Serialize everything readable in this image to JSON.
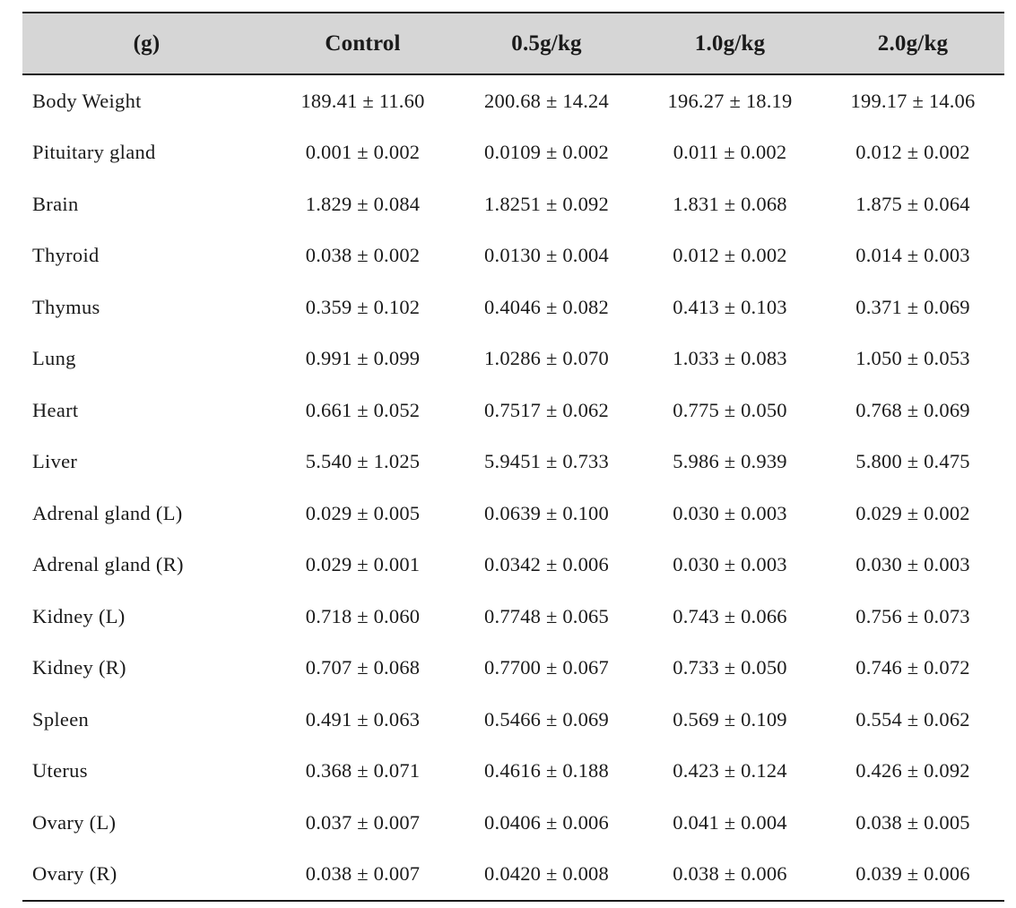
{
  "table": {
    "headers": [
      "(g)",
      "Control",
      "0.5g/kg",
      "1.0g/kg",
      "2.0g/kg"
    ],
    "header_background": "#d6d6d6",
    "rule_color": "#1a1a1a",
    "rows": [
      {
        "label": "Body Weight",
        "values": [
          "189.41 ± 11.60",
          "200.68 ± 14.24",
          "196.27 ± 18.19",
          "199.17 ± 14.06"
        ]
      },
      {
        "label": "Pituitary gland",
        "values": [
          "0.001 ± 0.002",
          "0.0109 ± 0.002",
          "0.011 ± 0.002",
          "0.012 ± 0.002"
        ]
      },
      {
        "label": "Brain",
        "values": [
          "1.829 ± 0.084",
          "1.8251 ± 0.092",
          "1.831 ± 0.068",
          "1.875 ± 0.064"
        ]
      },
      {
        "label": "Thyroid",
        "values": [
          "0.038 ± 0.002",
          "0.0130 ± 0.004",
          "0.012 ± 0.002",
          "0.014 ± 0.003"
        ]
      },
      {
        "label": "Thymus",
        "values": [
          "0.359 ± 0.102",
          "0.4046 ± 0.082",
          "0.413 ± 0.103",
          "0.371 ± 0.069"
        ]
      },
      {
        "label": "Lung",
        "values": [
          "0.991 ± 0.099",
          "1.0286 ± 0.070",
          "1.033 ± 0.083",
          "1.050 ± 0.053"
        ]
      },
      {
        "label": "Heart",
        "values": [
          "0.661 ± 0.052",
          "0.7517 ± 0.062",
          "0.775 ± 0.050",
          "0.768 ± 0.069"
        ]
      },
      {
        "label": "Liver",
        "values": [
          "5.540 ± 1.025",
          "5.9451 ± 0.733",
          "5.986 ± 0.939",
          "5.800 ± 0.475"
        ]
      },
      {
        "label": "Adrenal gland (L)",
        "values": [
          "0.029 ± 0.005",
          "0.0639 ± 0.100",
          "0.030 ± 0.003",
          "0.029 ± 0.002"
        ]
      },
      {
        "label": "Adrenal gland (R)",
        "values": [
          "0.029 ± 0.001",
          "0.0342 ± 0.006",
          "0.030 ± 0.003",
          "0.030 ± 0.003"
        ]
      },
      {
        "label": "Kidney (L)",
        "values": [
          "0.718 ± 0.060",
          "0.7748 ± 0.065",
          "0.743 ± 0.066",
          "0.756 ± 0.073"
        ]
      },
      {
        "label": "Kidney (R)",
        "values": [
          "0.707 ± 0.068",
          "0.7700 ± 0.067",
          "0.733 ± 0.050",
          "0.746 ± 0.072"
        ]
      },
      {
        "label": "Spleen",
        "values": [
          "0.491 ± 0.063",
          "0.5466 ± 0.069",
          "0.569 ± 0.109",
          "0.554 ± 0.062"
        ]
      },
      {
        "label": "Uterus",
        "values": [
          "0.368 ± 0.071",
          "0.4616 ± 0.188",
          "0.423 ± 0.124",
          "0.426 ± 0.092"
        ]
      },
      {
        "label": "Ovary (L)",
        "values": [
          "0.037 ± 0.007",
          "0.0406 ± 0.006",
          "0.041 ± 0.004",
          "0.038 ± 0.005"
        ]
      },
      {
        "label": "Ovary (R)",
        "values": [
          "0.038 ± 0.007",
          "0.0420 ± 0.008",
          "0.038 ± 0.006",
          "0.039 ± 0.006"
        ]
      }
    ]
  },
  "chart_data": {
    "type": "table",
    "title": "",
    "categories": [
      "Body Weight",
      "Pituitary gland",
      "Brain",
      "Thyroid",
      "Thymus",
      "Lung",
      "Heart",
      "Liver",
      "Adrenal gland (L)",
      "Adrenal gland (R)",
      "Kidney (L)",
      "Kidney (R)",
      "Spleen",
      "Uterus",
      "Ovary (L)",
      "Ovary (R)"
    ],
    "columns": [
      "(g)",
      "Control",
      "0.5g/kg",
      "1.0g/kg",
      "2.0g/kg"
    ],
    "series": [
      {
        "name": "Control",
        "values": [
          189.41,
          0.001,
          1.829,
          0.038,
          0.359,
          0.991,
          0.661,
          5.54,
          0.029,
          0.029,
          0.718,
          0.707,
          0.491,
          0.368,
          0.037,
          0.038
        ],
        "errors": [
          11.6,
          0.002,
          0.084,
          0.002,
          0.102,
          0.099,
          0.052,
          1.025,
          0.005,
          0.001,
          0.06,
          0.068,
          0.063,
          0.071,
          0.007,
          0.007
        ]
      },
      {
        "name": "0.5g/kg",
        "values": [
          200.68,
          0.0109,
          1.8251,
          0.013,
          0.4046,
          1.0286,
          0.7517,
          5.9451,
          0.0639,
          0.0342,
          0.7748,
          0.77,
          0.5466,
          0.4616,
          0.0406,
          0.042
        ],
        "errors": [
          14.24,
          0.002,
          0.092,
          0.004,
          0.082,
          0.07,
          0.062,
          0.733,
          0.1,
          0.006,
          0.065,
          0.067,
          0.069,
          0.188,
          0.006,
          0.008
        ]
      },
      {
        "name": "1.0g/kg",
        "values": [
          196.27,
          0.011,
          1.831,
          0.012,
          0.413,
          1.033,
          0.775,
          5.986,
          0.03,
          0.03,
          0.743,
          0.733,
          0.569,
          0.423,
          0.041,
          0.038
        ],
        "errors": [
          18.19,
          0.002,
          0.068,
          0.002,
          0.103,
          0.083,
          0.05,
          0.939,
          0.003,
          0.003,
          0.066,
          0.05,
          0.109,
          0.124,
          0.004,
          0.006
        ]
      },
      {
        "name": "2.0g/kg",
        "values": [
          199.17,
          0.012,
          1.875,
          0.014,
          0.371,
          1.05,
          0.768,
          5.8,
          0.029,
          0.03,
          0.756,
          0.746,
          0.554,
          0.426,
          0.038,
          0.039
        ],
        "errors": [
          14.06,
          0.002,
          0.064,
          0.003,
          0.069,
          0.053,
          0.069,
          0.475,
          0.002,
          0.003,
          0.073,
          0.072,
          0.062,
          0.092,
          0.005,
          0.006
        ]
      }
    ],
    "units": "g",
    "notation": "mean ± SD"
  }
}
